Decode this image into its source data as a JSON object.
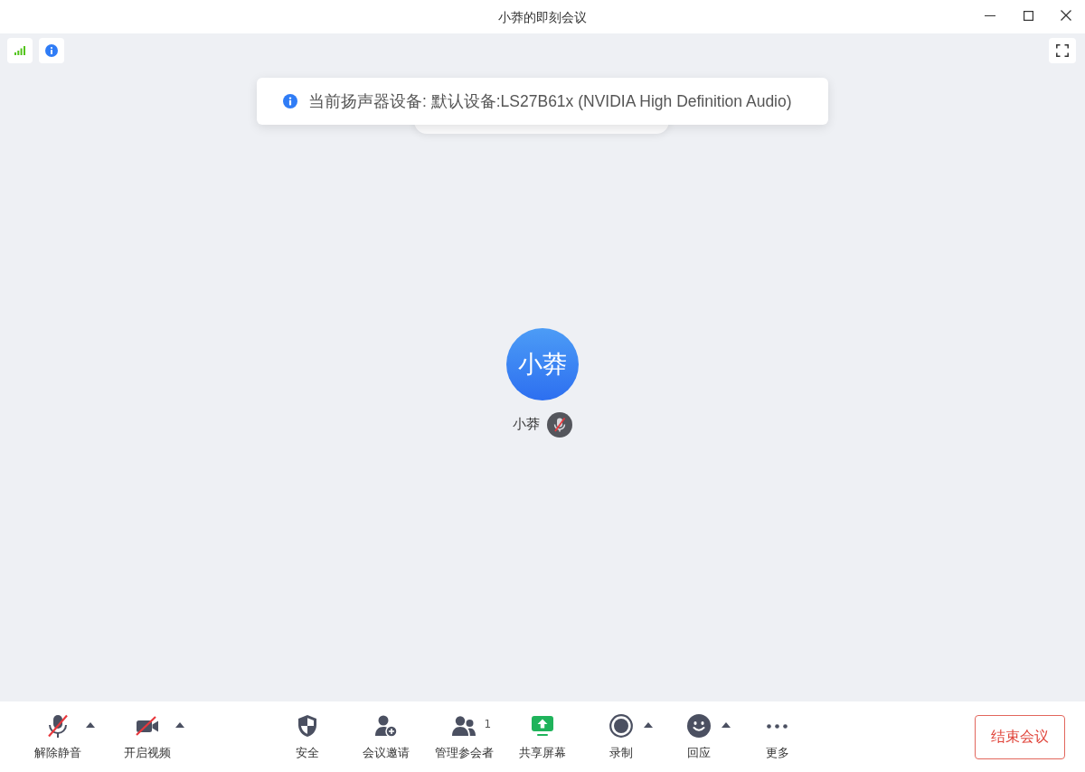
{
  "window": {
    "title": "小莽的即刻会议"
  },
  "toast": {
    "message": "当前扬声器设备: 默认设备:LS27B61x (NVIDIA High Definition Audio)"
  },
  "participant": {
    "avatar_text": "小莽",
    "name": "小莽",
    "muted": true
  },
  "toolbar": {
    "left_items": [
      {
        "kind": "microphone",
        "label": "解除静音",
        "off": true,
        "has_menu": true
      },
      {
        "kind": "camera",
        "label": "开启视频",
        "off": true,
        "has_menu": true
      }
    ],
    "center_items": [
      {
        "kind": "shield",
        "label": "安全",
        "has_menu": false
      },
      {
        "kind": "invite",
        "label": "会议邀请",
        "has_menu": false
      },
      {
        "kind": "participants",
        "label": "管理参会者",
        "count": "1",
        "has_menu": false
      },
      {
        "kind": "share",
        "label": "共享屏幕",
        "has_menu": false
      },
      {
        "kind": "record",
        "label": "录制",
        "has_menu": true
      },
      {
        "kind": "reaction",
        "label": "回应",
        "has_menu": true
      },
      {
        "kind": "more",
        "label": "更多",
        "has_menu": false
      }
    ],
    "end_button": "结束会议"
  }
}
